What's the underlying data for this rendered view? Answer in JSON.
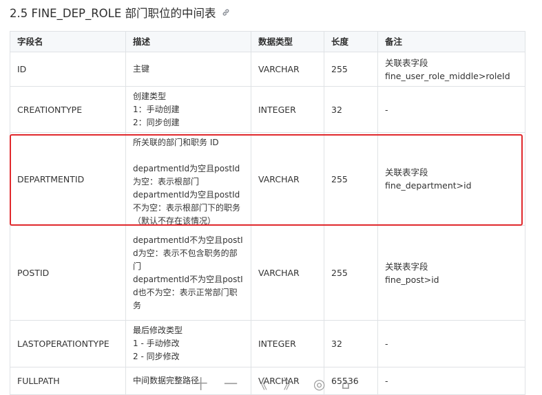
{
  "section": {
    "title": "2.5 FINE_DEP_ROLE  部门职位的中间表",
    "anchor_icon": "link-icon"
  },
  "table": {
    "headers": [
      "字段名",
      "描述",
      "数据类型",
      "长度",
      "备注"
    ],
    "rows": [
      {
        "field": "ID",
        "description": "主键",
        "type": "VARCHAR",
        "length": "255",
        "note": "关联表字段\nfine_user_role_middle>roleId"
      },
      {
        "field": "CREATIONTYPE",
        "description": "创建类型\n1：手动创建\n2：同步创建",
        "type": "INTEGER",
        "length": "32",
        "note": "-"
      },
      {
        "field": "DEPARTMENTID",
        "description": "所关联的部门和职务 ID\n\ndepartmentId为空且postId为空：表示根部门\ndepartmentId为空且postId不为空：表示根部门下的职务（默认不存在该情况）",
        "type": "VARCHAR",
        "length": "255",
        "note": "关联表字段\nfine_department>id"
      },
      {
        "field": "POSTID",
        "description": "departmentId不为空且postId为空：表示不包含职务的部门\ndepartmentId不为空且postId也不为空：表示正常部门职务",
        "type": "VARCHAR",
        "length": "255",
        "note": "关联表字段\nfine_post>id"
      },
      {
        "field": "LASTOPERATIONTYPE",
        "description": "最后修改类型\n1 - 手动修改\n2 - 同步修改",
        "type": "INTEGER",
        "length": "32",
        "note": "-"
      },
      {
        "field": "FULLPATH",
        "description": "中间数据完整路径",
        "type": "VARCHAR",
        "length": "65536",
        "note": "-"
      }
    ]
  },
  "viewer_toolbar": {
    "icons": [
      "zoom-in-icon",
      "zoom-out-icon",
      "prev-icon",
      "next-icon",
      "rotate-icon",
      "delete-icon"
    ],
    "glyphs": [
      "十",
      "一",
      "《",
      "》",
      "◎",
      "⌂"
    ]
  },
  "colors": {
    "highlight_border": "#e0272b",
    "table_border": "#dfe2e5",
    "header_bg": "#f6f8fa"
  }
}
